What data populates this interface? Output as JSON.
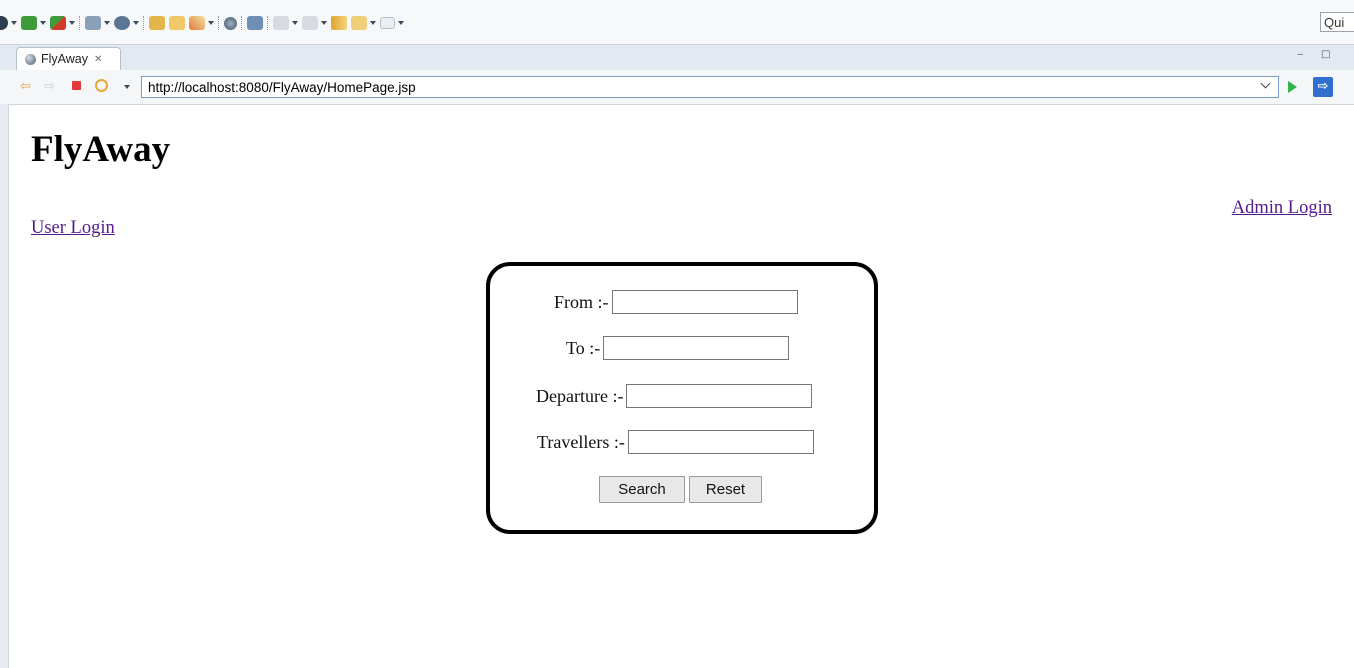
{
  "toolbar": {
    "quick_access_text": "Qui",
    "icons": [
      "run-icon",
      "debug-icon",
      "coverage-icon",
      "new-server-icon",
      "external-tools-icon",
      "open-folder-icon",
      "open-file-icon",
      "pen-icon",
      "globe-icon",
      "search-icon",
      "prev-annotation-icon",
      "next-annotation-icon",
      "back-icon",
      "forward-icon",
      "forward-alt-icon"
    ]
  },
  "tab": {
    "label": "FlyAway",
    "close_glyph": "✕"
  },
  "window": {
    "minimize_glyph": "‒",
    "maximize_glyph": "□"
  },
  "browser": {
    "back_glyph": "⇦",
    "forward_glyph": "⇨",
    "url": "http://localhost:8080/FlyAway/HomePage.jsp",
    "go_label": "",
    "external_glyph": "⇨"
  },
  "page": {
    "title": "FlyAway",
    "user_login": "User Login",
    "admin_login": "Admin Login",
    "form": {
      "from_label": "From :-",
      "from_value": "",
      "to_label": "To :-",
      "to_value": "",
      "departure_label": "Departure :-",
      "departure_value": "",
      "travellers_label": "Travellers :-",
      "travellers_value": "",
      "search_button": "Search",
      "reset_button": "Reset"
    }
  },
  "colors": {
    "link_visited": "#551a8b",
    "tabbar_bg": "#e3e9f1",
    "go_green": "#2fb34a",
    "ext_blue": "#2e6fd0"
  }
}
